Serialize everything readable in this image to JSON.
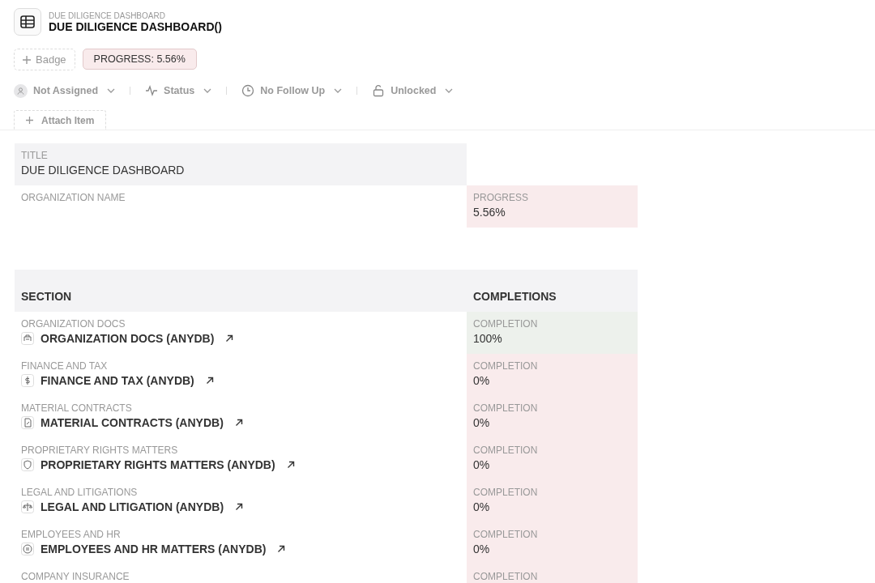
{
  "header": {
    "breadcrumb": "DUE DILIGENCE DASHBOARD",
    "title": "DUE DILIGENCE DASHBOARD()"
  },
  "badges": {
    "add_label": "Badge",
    "progress_badge": "PROGRESS: 5.56%"
  },
  "toolbar": [
    {
      "label": "Not Assigned"
    },
    {
      "label": "Status"
    },
    {
      "label": "No Follow Up"
    },
    {
      "label": "Unlocked"
    }
  ],
  "attach": {
    "label": "Attach Item"
  },
  "title_field": {
    "label": "TITLE",
    "value": "DUE DILIGENCE DASHBOARD"
  },
  "organization_field": {
    "label": "ORGANIZATION NAME"
  },
  "progress_field": {
    "label": "PROGRESS",
    "value": "5.56%"
  },
  "table": {
    "columns": [
      "SECTION",
      "COMPLETIONS"
    ],
    "rows": [
      {
        "category": "ORGANIZATION DOCS",
        "link": "ORGANIZATION DOCS (ANYDB)",
        "completion_label": "COMPLETION",
        "completion": "100%",
        "color": "#edf1ec"
      },
      {
        "category": "FINANCE AND TAX",
        "link": "FINANCE AND TAX (ANYDB)",
        "completion_label": "COMPLETION",
        "completion": "0%",
        "color": "#f9ebec"
      },
      {
        "category": "MATERIAL CONTRACTS",
        "link": "MATERIAL CONTRACTS (ANYDB)",
        "completion_label": "COMPLETION",
        "completion": "0%",
        "color": "#f9ebec"
      },
      {
        "category": "PROPRIETARY RIGHTS MATTERS",
        "link": "PROPRIETARY RIGHTS MATTERS (ANYDB)",
        "completion_label": "COMPLETION",
        "completion": "0%",
        "color": "#f9ebec"
      },
      {
        "category": "LEGAL AND LITIGATIONS",
        "link": "LEGAL AND LITIGATION (ANYDB)",
        "completion_label": "COMPLETION",
        "completion": "0%",
        "color": "#f9ebec"
      },
      {
        "category": "EMPLOYEES AND HR",
        "link": "EMPLOYEES AND HR MATTERS (ANYDB)",
        "completion_label": "COMPLETION",
        "completion": "0%",
        "color": "#f9ebec"
      },
      {
        "category": "COMPANY INSURANCE",
        "completion_label": "COMPLETION",
        "color": "#f9ebec"
      }
    ]
  }
}
